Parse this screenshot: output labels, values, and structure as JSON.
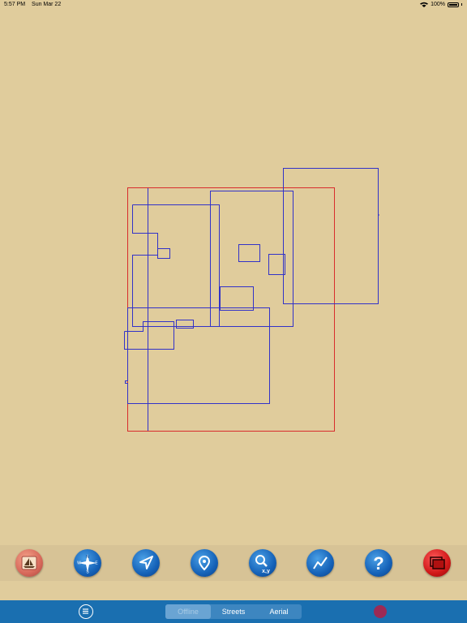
{
  "status_bar": {
    "time": "5:57 PM",
    "date": "Sun Mar 22",
    "battery": "100%"
  },
  "toolbar": {
    "buttons": [
      {
        "name": "boat-button",
        "icon": "sailboat-icon"
      },
      {
        "name": "compass-button",
        "icon": "compass-icon",
        "label": "N W E S"
      },
      {
        "name": "navigate-button",
        "icon": "navigation-arrow-icon"
      },
      {
        "name": "waypoint-button",
        "icon": "map-pin-icon"
      },
      {
        "name": "coordinate-search-button",
        "icon": "search-xy-icon",
        "label": "x,y"
      },
      {
        "name": "route-button",
        "icon": "route-icon"
      },
      {
        "name": "help-button",
        "icon": "question-icon",
        "label": "?"
      },
      {
        "name": "screens-button",
        "icon": "windows-icon"
      }
    ]
  },
  "bottom_bar": {
    "segments": [
      "Offline",
      "Streets",
      "Aerial"
    ],
    "active_segment": "Offline"
  },
  "colors": {
    "background": "#e0cc9c",
    "chart_outline_blue": "#3232c8",
    "chart_outline_red": "#d82c2c",
    "bottom_bar": "#1a6fb0"
  }
}
